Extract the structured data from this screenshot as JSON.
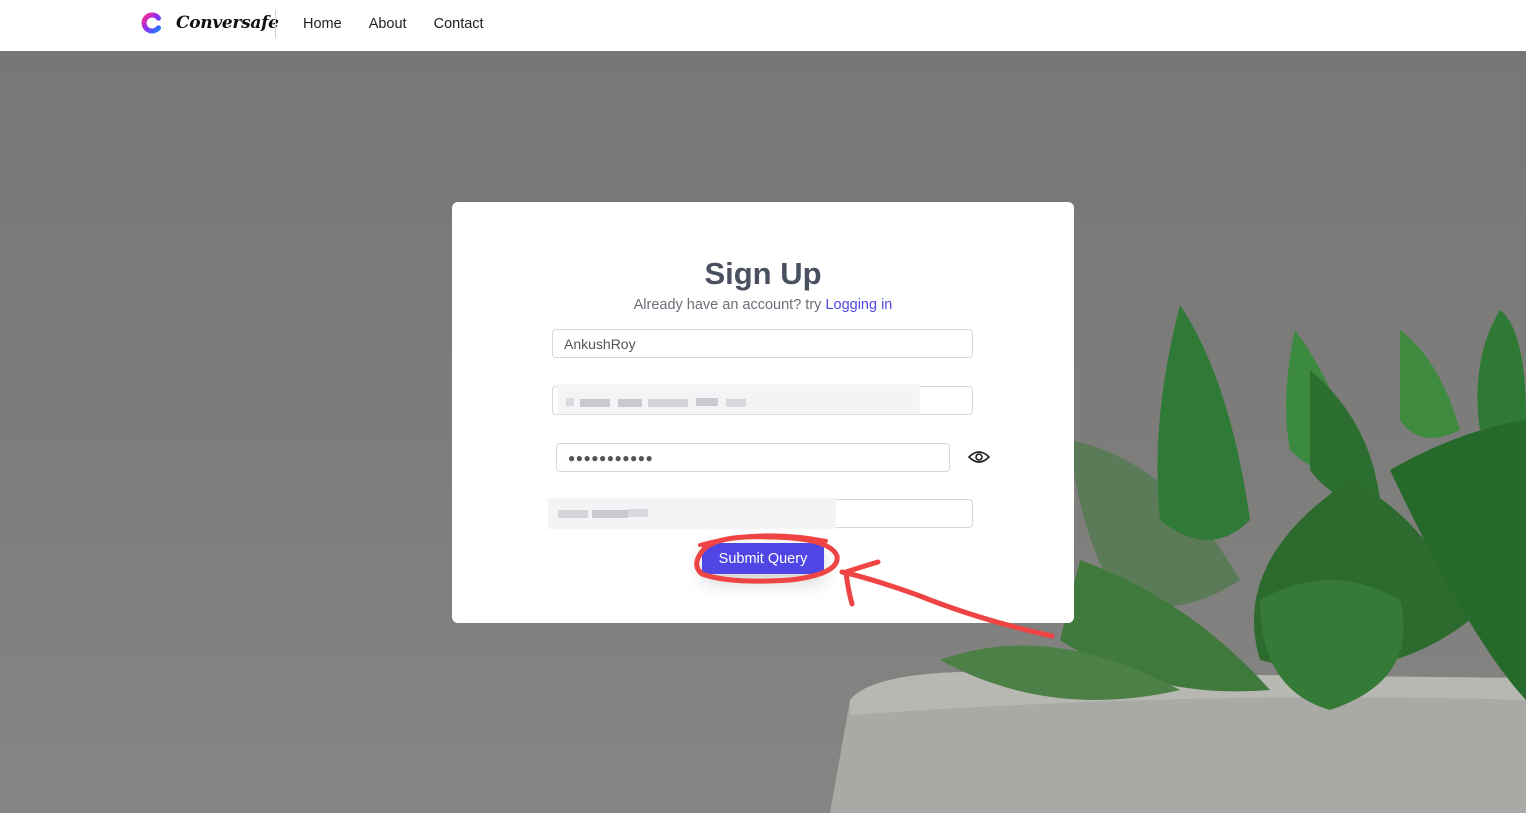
{
  "brand": {
    "name": "Conversafe",
    "logo_icon": "conversafe-logo-icon"
  },
  "nav": {
    "items": [
      {
        "label": "Home"
      },
      {
        "label": "About"
      },
      {
        "label": "Contact"
      }
    ]
  },
  "signup": {
    "title": "Sign Up",
    "subtitle_prefix": "Already have an account? try ",
    "login_link": "Logging in",
    "username_value": "AnkushRoy",
    "password_mask": "●●●●●●●●●●●",
    "show_password_icon": "eye-icon",
    "submit_label": "Submit Query"
  },
  "colors": {
    "accent": "#4f46e5",
    "heading": "#4a5060",
    "annotation": "#ef4444"
  }
}
